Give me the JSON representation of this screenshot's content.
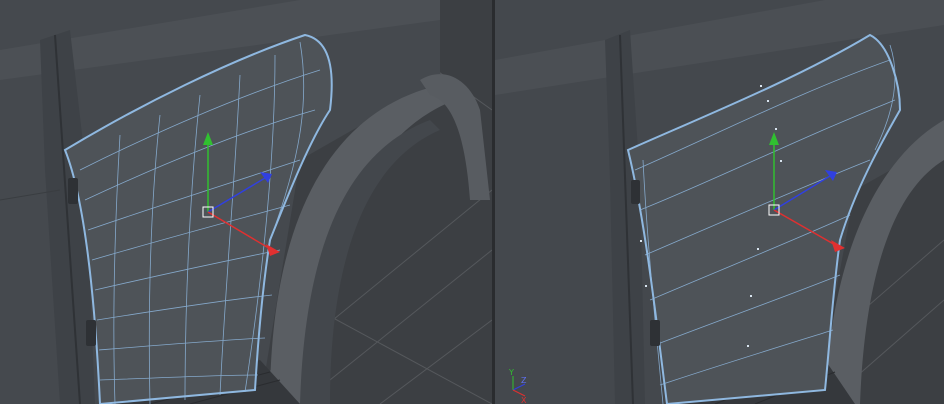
{
  "viewports": {
    "left": {
      "view": "perspective"
    },
    "right": {
      "view": "perspective"
    }
  },
  "axis_indicator": {
    "x_label": "X",
    "y_label": "Y",
    "z_label": "Z"
  },
  "colors": {
    "background": "#3c3f43",
    "body_panel": "#4a4e53",
    "wire": "#8fb8e0",
    "axis_x": "#e03030",
    "axis_y": "#30c030",
    "axis_z": "#3040e0"
  }
}
